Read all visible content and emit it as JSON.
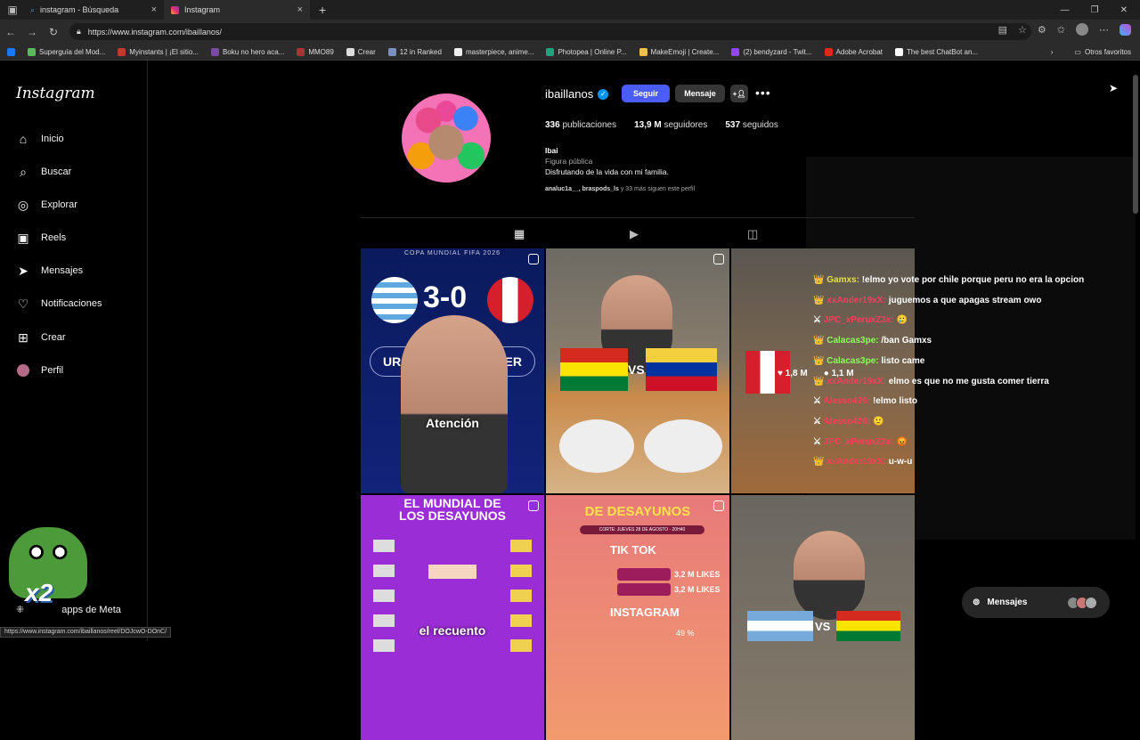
{
  "browser": {
    "tabs": [
      {
        "title": "instagram - Búsqueda"
      },
      {
        "title": "Instagram"
      }
    ],
    "new_tab": "+",
    "url": "https://www.instagram.com/ibaillanos/",
    "bookmarks": [
      {
        "label": "Superguía del Mod..."
      },
      {
        "label": "Myinstants | ¡El sitio..."
      },
      {
        "label": "Boku no hero aca..."
      },
      {
        "label": "MMO89"
      },
      {
        "label": "Crear"
      },
      {
        "label": "12 in Ranked"
      },
      {
        "label": "masterpiece, anime..."
      },
      {
        "label": "Photopea | Online P..."
      },
      {
        "label": "MakeEmoji | Create..."
      },
      {
        "label": "(2) bendyzard - Twit..."
      },
      {
        "label": "Adobe Acrobat"
      },
      {
        "label": "The best ChatBot an..."
      }
    ],
    "other_favorites": "Otros favoritos",
    "status_url": "https://www.instagram.com/ibaillanos/reel/DOJcwO-DOnC/"
  },
  "sidebar": {
    "logo": "Instagram",
    "items": [
      {
        "label": "Inicio",
        "icon": "home-icon"
      },
      {
        "label": "Buscar",
        "icon": "search-icon"
      },
      {
        "label": "Explorar",
        "icon": "compass-icon"
      },
      {
        "label": "Reels",
        "icon": "reels-icon"
      },
      {
        "label": "Mensajes",
        "icon": "messenger-icon"
      },
      {
        "label": "Notificaciones",
        "icon": "heart-icon"
      },
      {
        "label": "Crear",
        "icon": "plus-square-icon"
      },
      {
        "label": "Perfil",
        "icon": "avatar-icon"
      }
    ],
    "more_label": "apps de Meta"
  },
  "profile": {
    "username": "ibaillanos",
    "follow": "Seguir",
    "message": "Mensaje",
    "stats": {
      "posts_num": "336",
      "posts_label": "publicaciones",
      "followers_num": "13,9 M",
      "followers_label": "seguidores",
      "following_num": "537",
      "following_label": "seguidos"
    },
    "name": "Ibai",
    "category": "Figura pública",
    "bio": "Disfrutando de la vida con mi familia.",
    "followed_by_names": "analuc1a__, braspods_ls",
    "followed_by_rest": "y 33 más siguen este perfil"
  },
  "posts": {
    "p1": {
      "header": "COPA MUNDIAL FIFA 2026",
      "score": "3-0",
      "left": "UR",
      "right": "PER",
      "caption": "Atención"
    },
    "p2": {
      "vs": "VS"
    },
    "p3": {
      "likes": "1,8 M",
      "comments": "1,1 M"
    },
    "p4": {
      "title_line1": "EL MUNDIAL DE",
      "title_line2": "LOS DESAYUNOS",
      "caption": "el recuento"
    },
    "p5": {
      "title": "DE DESAYUNOS",
      "cut": "CORTE: JUEVES 28 DE AGOSTO - 20H40",
      "tiktok": "TIK TOK",
      "likes1": "3,2 M LIKES",
      "likes2": "3,2 M LIKES",
      "instagram": "INSTAGRAM",
      "pct": "49 %"
    },
    "p6": {
      "vs": "VS"
    }
  },
  "chat": [
    {
      "user": "Gamxs:",
      "msg": "!elmo yo vote por chile porque peru no era la opcion",
      "color": "yellow"
    },
    {
      "user": "xxAnder19xX:",
      "msg": "juguemos a que apagas stream owo",
      "color": "red"
    },
    {
      "user": "JPC_xPeruxZ3x:",
      "msg": "🥲",
      "color": "red"
    },
    {
      "user": "Calacas3pe:",
      "msg": "/ban Gamxs",
      "color": "green"
    },
    {
      "user": "Calacas3pe:",
      "msg": "listo came",
      "color": "green"
    },
    {
      "user": "xxAnder19xX:",
      "msg": "elmo es que no me gusta comer tierra",
      "color": "red"
    },
    {
      "user": "Alesso426:",
      "msg": "!elmo listo",
      "color": "red"
    },
    {
      "user": "Alesso426:",
      "msg": "🙂",
      "color": "red"
    },
    {
      "user": "JPC_xPeruxZ3x:",
      "msg": "😡",
      "color": "red"
    },
    {
      "user": "xxAnder19xX:",
      "msg": "u-w-u",
      "color": "red"
    }
  ],
  "overlay": {
    "x2": "x2"
  },
  "messages_pill": {
    "label": "Mensajes"
  }
}
